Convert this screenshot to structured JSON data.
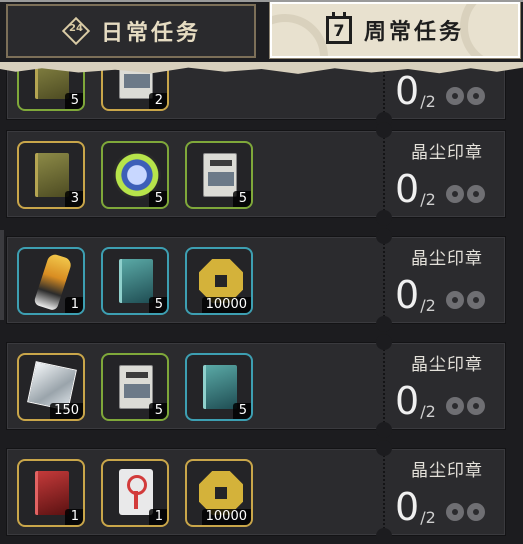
{
  "tabs": {
    "daily": {
      "label": "日常任务",
      "icon_text": "24",
      "icon": "24h-diamond-icon"
    },
    "weekly": {
      "label": "周常任务",
      "icon_text": "7",
      "icon": "calendar-icon"
    }
  },
  "tasks": [
    {
      "title": "",
      "progress": {
        "current": "0",
        "total": "/2"
      },
      "rewards": [
        {
          "name": "partial-item",
          "qty": "5",
          "frame": "green",
          "art": "book olive"
        },
        {
          "name": "partial-item",
          "qty": "2",
          "frame": "gold",
          "art": "book news"
        }
      ]
    },
    {
      "title": "晶尘印章",
      "progress": {
        "current": "0",
        "total": "/2"
      },
      "rewards": [
        {
          "name": "manufacture-request-book",
          "qty": "3",
          "frame": "gold",
          "art": "book olive"
        },
        {
          "name": "glove-orb",
          "qty": "5",
          "frame": "green",
          "art": "glove"
        },
        {
          "name": "newspaper-book",
          "qty": "5",
          "frame": "green",
          "art": "book news"
        }
      ]
    },
    {
      "title": "晶尘印章",
      "progress": {
        "current": "0",
        "total": "/2"
      },
      "rewards": [
        {
          "name": "bottle",
          "qty": "1",
          "frame": "blue",
          "art": "bottle"
        },
        {
          "name": "manufacture-request-book-teal",
          "qty": "5",
          "frame": "blue",
          "art": "book teal"
        },
        {
          "name": "gold-coin",
          "qty": "10000",
          "frame": "blue",
          "art": "coin"
        }
      ]
    },
    {
      "title": "晶尘印章",
      "progress": {
        "current": "0",
        "total": "/2"
      },
      "rewards": [
        {
          "name": "crystal-cube",
          "qty": "150",
          "frame": "gold",
          "art": "cube"
        },
        {
          "name": "newspaper-book",
          "qty": "5",
          "frame": "green",
          "art": "book news"
        },
        {
          "name": "manufacture-request-book-teal",
          "qty": "5",
          "frame": "blue",
          "art": "book teal"
        }
      ]
    },
    {
      "title": "晶尘印章",
      "progress": {
        "current": "0",
        "total": "/2"
      },
      "rewards": [
        {
          "name": "manufacture-request-book-red",
          "qty": "1",
          "frame": "gold",
          "art": "book red"
        },
        {
          "name": "key-card",
          "qty": "1",
          "frame": "gold",
          "art": "keycard"
        },
        {
          "name": "gold-coin",
          "qty": "10000",
          "frame": "gold",
          "art": "coin"
        }
      ]
    }
  ]
}
